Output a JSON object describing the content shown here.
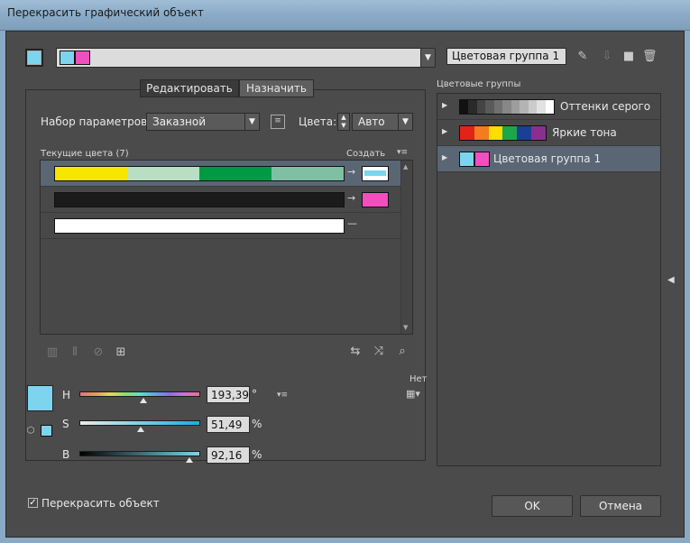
{
  "window": {
    "title": "Перекрасить графический объект"
  },
  "top": {
    "group_name": "Цветовая группа 1",
    "colors": {
      "cyan": "#7dd4ee",
      "pink": "#f04fbf"
    }
  },
  "tabs": [
    {
      "label": "Редактировать",
      "active": true
    },
    {
      "label": "Назначить",
      "active": false
    }
  ],
  "preset": {
    "label": "Набор параметров:",
    "value": "Заказной"
  },
  "colors_count": {
    "label": "Цвета:",
    "value": "Авто"
  },
  "current_colors": {
    "header": "Текущие цвета (7)",
    "create_label": "Создать"
  },
  "rows": [
    {
      "segments": [
        "#f6e600",
        "#b8dfc4",
        "#009a44",
        "#7fc0a4"
      ],
      "new_colors": [
        "#7dd4ee",
        "#ffffff"
      ]
    },
    {
      "segments": [
        "#1b1b1b"
      ],
      "new_colors": [
        "#f04fbf"
      ]
    },
    {
      "segments": [
        "#ffffff"
      ],
      "new_colors": []
    }
  ],
  "hsb": {
    "h": {
      "label": "H",
      "value": "193,39",
      "unit": "°",
      "fraction": 0.537
    },
    "s": {
      "label": "S",
      "value": "51,49",
      "unit": "%",
      "fraction": 0.515
    },
    "b": {
      "label": "B",
      "value": "92,16",
      "unit": "%",
      "fraction": 0.922
    },
    "none_label": "Нет",
    "current_color": "#7dd4ee"
  },
  "recolor_checkbox": {
    "label": "Перекрасить объект",
    "checked": true
  },
  "buttons": {
    "ok": "OK",
    "cancel": "Отмена"
  },
  "groups_panel": {
    "header": "Цветовые группы",
    "items": [
      {
        "name": "Оттенки серого",
        "colors": [
          "#111111",
          "#2a2a2a",
          "#444444",
          "#5a5a5a",
          "#707070",
          "#878787",
          "#9d9d9d",
          "#b4b4b4",
          "#cbcbcb",
          "#e2e2e2",
          "#ffffff"
        ]
      },
      {
        "name": "Яркие тона",
        "colors": [
          "#e2231a",
          "#f47b20",
          "#ffdd00",
          "#1aa84b",
          "#1b3f95",
          "#8b2f8f"
        ]
      },
      {
        "name": "Цветовая группа 1",
        "colors": [
          "#7dd4ee",
          "#f04fbf"
        ],
        "selected": true
      }
    ]
  }
}
